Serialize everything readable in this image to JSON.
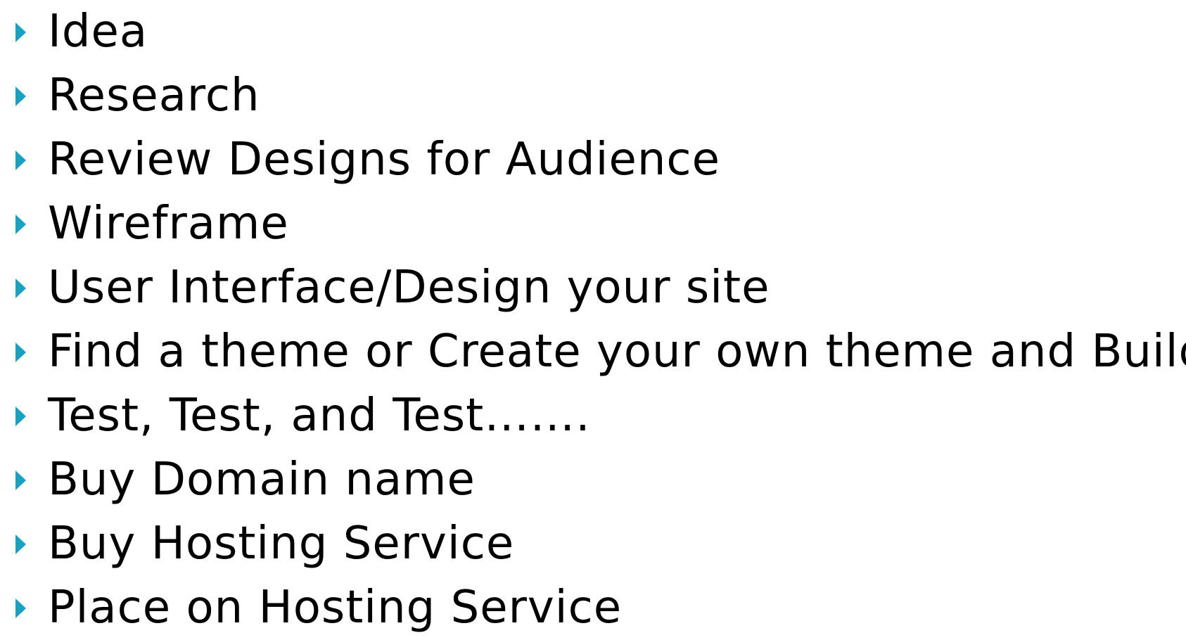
{
  "bullet_color": "#1aa0c0",
  "marker_icon": "triangle-right-icon",
  "items": [
    {
      "label": "Idea"
    },
    {
      "label": "Research"
    },
    {
      "label": "Review Designs for Audience"
    },
    {
      "label": "Wireframe"
    },
    {
      "label": "User Interface/Design your site"
    },
    {
      "label": "Find a theme or Create your own theme and Build"
    },
    {
      "label": "Test, Test, and Test……."
    },
    {
      "label": "Buy Domain name"
    },
    {
      "label": "Buy Hosting Service"
    },
    {
      "label": "Place on Hosting Service"
    }
  ]
}
